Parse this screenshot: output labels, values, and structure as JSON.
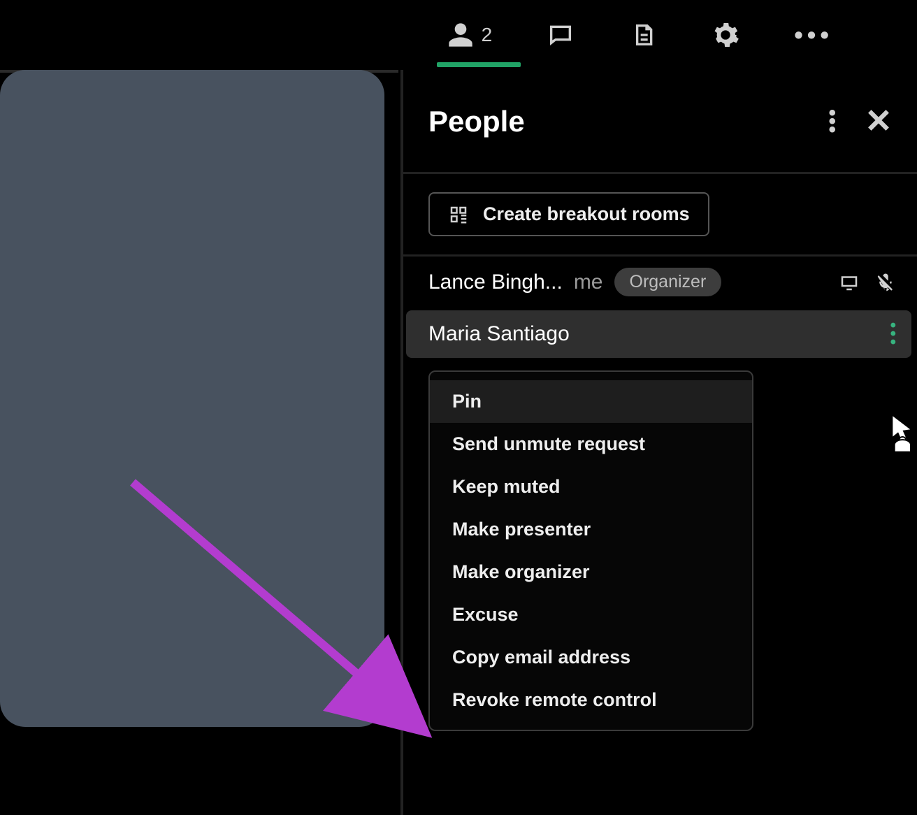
{
  "toolbar": {
    "people_count": "2"
  },
  "panel": {
    "title": "People",
    "breakout_label": "Create breakout rooms"
  },
  "participants": [
    {
      "name": "Lance Bingh...",
      "me_label": "me",
      "badge": "Organizer"
    },
    {
      "name": "Maria Santiago"
    }
  ],
  "menu": {
    "items": [
      "Pin",
      "Send unmute request",
      "Keep muted",
      "Make presenter",
      "Make organizer",
      "Excuse",
      "Copy email address",
      "Revoke remote control"
    ]
  }
}
